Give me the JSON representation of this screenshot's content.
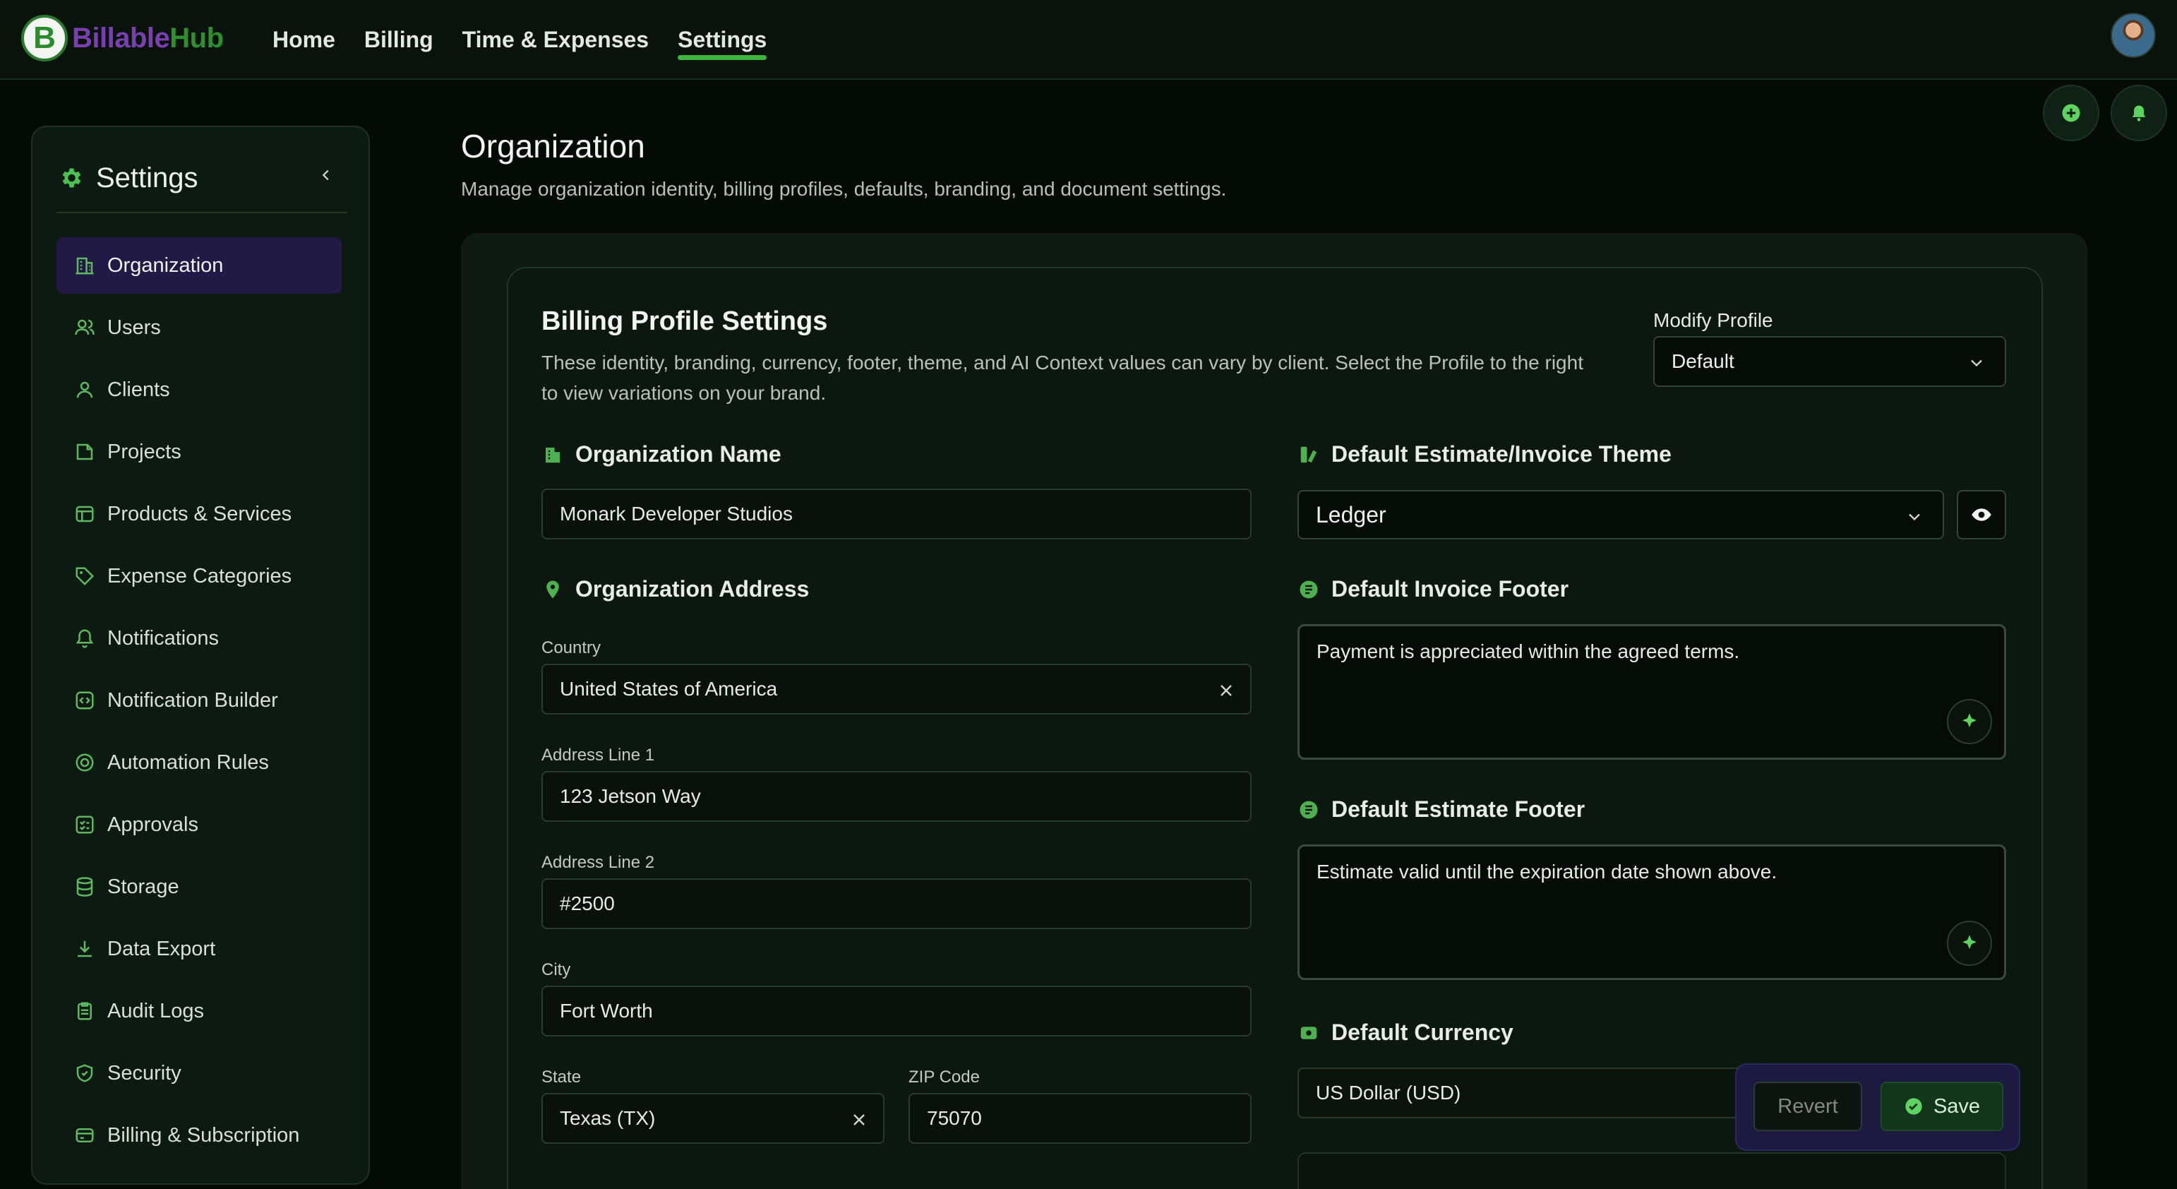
{
  "app": {
    "name_part1": "Billable",
    "name_part2": "Hub",
    "logo_letter": "B"
  },
  "nav": {
    "items": [
      {
        "label": "Home",
        "active": false
      },
      {
        "label": "Billing",
        "active": false
      },
      {
        "label": "Time & Expenses",
        "active": false
      },
      {
        "label": "Settings",
        "active": true
      }
    ]
  },
  "header_actions": {
    "add_icon": "plus-circle-icon",
    "notify_icon": "bell-icon",
    "avatar": "user-avatar"
  },
  "sidebar": {
    "title": "Settings",
    "title_icon": "gear-icon",
    "items": [
      {
        "label": "Organization",
        "icon": "building-icon",
        "active": true
      },
      {
        "label": "Users",
        "icon": "users-icon"
      },
      {
        "label": "Clients",
        "icon": "user-icon"
      },
      {
        "label": "Projects",
        "icon": "folder-icon"
      },
      {
        "label": "Products & Services",
        "icon": "box-icon"
      },
      {
        "label": "Expense Categories",
        "icon": "tag-icon"
      },
      {
        "label": "Notifications",
        "icon": "bell-icon"
      },
      {
        "label": "Notification Builder",
        "icon": "code-icon"
      },
      {
        "label": "Automation Rules",
        "icon": "target-icon"
      },
      {
        "label": "Approvals",
        "icon": "checklist-icon"
      },
      {
        "label": "Storage",
        "icon": "database-icon"
      },
      {
        "label": "Data Export",
        "icon": "download-icon"
      },
      {
        "label": "Audit Logs",
        "icon": "clipboard-icon"
      },
      {
        "label": "Security",
        "icon": "shield-icon"
      },
      {
        "label": "Billing & Subscription",
        "icon": "card-icon"
      }
    ]
  },
  "page": {
    "title": "Organization",
    "subtitle": "Manage organization identity, billing profiles, defaults, branding, and document settings."
  },
  "billing_profile": {
    "title": "Billing Profile Settings",
    "description": "These identity, branding, currency, footer, theme, and AI Context values can vary by client. Select the Profile to the right to view variations on your brand.",
    "modify_label": "Modify Profile",
    "modify_value": "Default"
  },
  "organization": {
    "name_label": "Organization Name",
    "name_value": "Monark Developer Studios",
    "address_label": "Organization Address",
    "country_label": "Country",
    "country_value": "United States of America",
    "addr1_label": "Address Line 1",
    "addr1_value": "123 Jetson Way",
    "addr2_label": "Address Line 2",
    "addr2_value": "#2500",
    "city_label": "City",
    "city_value": "Fort Worth",
    "state_label": "State",
    "state_value": "Texas (TX)",
    "zip_label": "ZIP Code",
    "zip_value": "75070"
  },
  "defaults": {
    "theme_label": "Default Estimate/Invoice Theme",
    "theme_value": "Ledger",
    "invoice_footer_label": "Default Invoice Footer",
    "invoice_footer_value": "Payment is appreciated within the agreed terms.",
    "estimate_footer_label": "Default Estimate Footer",
    "estimate_footer_value": "Estimate valid until the expiration date shown above.",
    "currency_label": "Default Currency",
    "currency_value": "US Dollar (USD)"
  },
  "actions": {
    "revert_label": "Revert",
    "save_label": "Save"
  },
  "colors": {
    "accent": "#3fb53f",
    "active_nav_bg": "#201a45",
    "background": "#040b06"
  }
}
